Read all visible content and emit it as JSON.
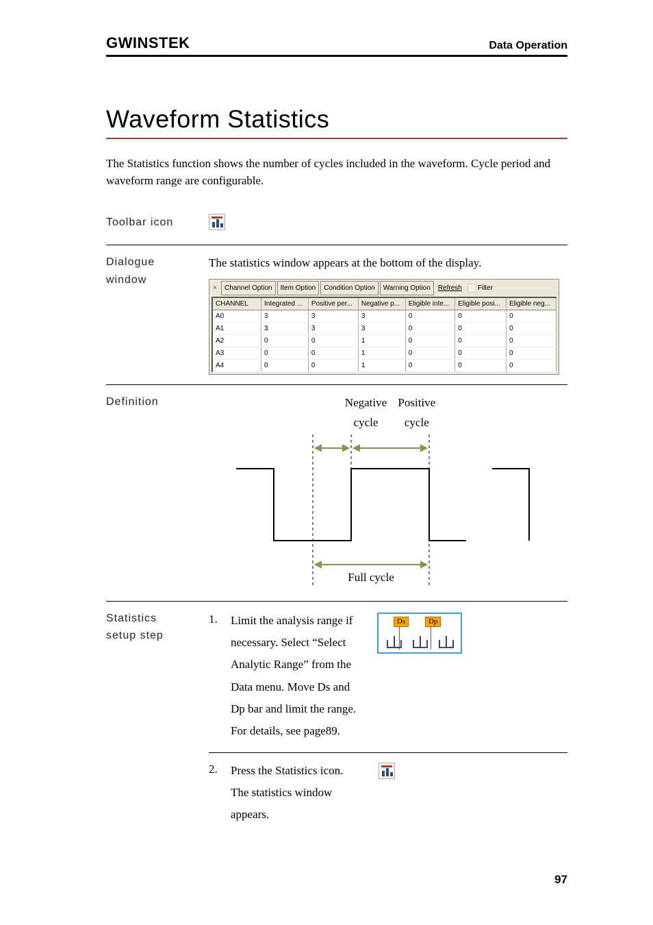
{
  "header": {
    "brand": "GWINSTEK",
    "section": "Data Operation"
  },
  "title": "Waveform Statistics",
  "intro": "The Statistics function shows the number of cycles included in the waveform. Cycle period and waveform range are configurable.",
  "labels": {
    "toolbar": "Toolbar icon",
    "dialogue1": "Dialogue",
    "dialogue2": "window",
    "definition": "Definition",
    "stats1": "Statistics",
    "stats2": "setup step"
  },
  "dialogue_desc": "The statistics window appears at the bottom of the display.",
  "stat_window": {
    "buttons": [
      "Channel Option",
      "Item Option",
      "Condition Option",
      "Warning Option"
    ],
    "refresh": "Refresh",
    "filter": "Filter",
    "columns": [
      "CHANNEL",
      "Integrated ...",
      "Positive per...",
      "Negative p...",
      "Eligible inte...",
      "Eligible posi...",
      "Eligible neg..."
    ],
    "rows": [
      [
        "A0",
        "3",
        "3",
        "3",
        "0",
        "0",
        "0"
      ],
      [
        "A1",
        "3",
        "3",
        "3",
        "0",
        "0",
        "0"
      ],
      [
        "A2",
        "0",
        "0",
        "1",
        "0",
        "0",
        "0"
      ],
      [
        "A3",
        "0",
        "0",
        "1",
        "0",
        "0",
        "0"
      ],
      [
        "A4",
        "0",
        "0",
        "1",
        "0",
        "0",
        "0"
      ]
    ]
  },
  "definition": {
    "neg_label1": "Negative",
    "neg_label2": "cycle",
    "pos_label1": "Positive",
    "pos_label2": "cycle",
    "full_label": "Full cycle"
  },
  "steps": {
    "s1_num": "1.",
    "s1_text": "Limit the analysis range if necessary. Select “Select Analytic Range” from the Data menu. Move Ds and Dp bar and limit the range. For details, see page89.",
    "s2_num": "2.",
    "s2_text": "Press the Statistics icon. The statistics window appears.",
    "ds": "Ds",
    "dp": "Dp"
  },
  "page_number": "97"
}
